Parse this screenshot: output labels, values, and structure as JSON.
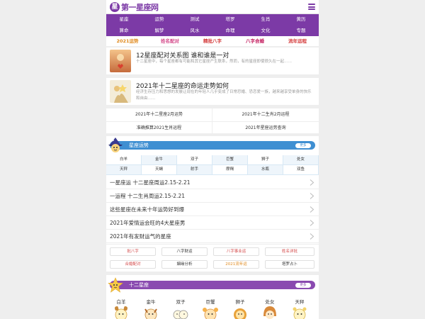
{
  "header": {
    "logo_text": "第一星座网",
    "logo_mark": "星"
  },
  "nav": {
    "row1": [
      "星座",
      "运势",
      "测试",
      "塔罗",
      "生肖",
      "黄历"
    ],
    "row2": [
      "算命",
      "解梦",
      "风水",
      "命理",
      "文化",
      "专题"
    ]
  },
  "hot_links": [
    {
      "label": "2021运势",
      "color": "#e08a1e"
    },
    {
      "label": "姓名配对",
      "color": "#d44a8a"
    },
    {
      "label": "精批八字",
      "color": "#d43b3b"
    },
    {
      "label": "八字合婚",
      "color": "#c2185b"
    },
    {
      "label": "流年运程",
      "color": "#d43b3b"
    }
  ],
  "articles": [
    {
      "title": "12星座配对关系图 谁和谁是一对",
      "desc": "十二星座中，每个星座都有可能和其它星座产生联系，然而，有的星座即使很久在一起……"
    },
    {
      "title": "2021年十二星座的命运走势如何",
      "desc": "经济生存压力和思想的发展让现在的年轻人几乎变成了日常恐婚、恐恋爱一族，越来越享受单身的快乐和自由……"
    }
  ],
  "link_grid": [
    "2021年十二星座2月运势",
    "2021年十二生肖2月运程",
    "准确推算2021生肖运程",
    "2021年星座运势查询"
  ],
  "horoscope": {
    "title": "星座运势",
    "more": "更多",
    "signs": [
      "白羊",
      "金牛",
      "双子",
      "巨蟹",
      "狮子",
      "处女",
      "天秤",
      "天蝎",
      "射手",
      "摩羯",
      "水瓶",
      "双鱼"
    ]
  },
  "articles_list": [
    "一星座运 十二星座周运2.15-2.21",
    "一运程 十二生肖周运2.15-2.21",
    "这些星座在未来十年运势好到爆",
    "2021年爱情运会旺的4大星座男",
    "2021年有发财运气的星座"
  ],
  "tags": [
    {
      "label": "批八字",
      "color": "#d44a4a"
    },
    {
      "label": "八字财运",
      "color": "#333333"
    },
    {
      "label": "八字事业运",
      "color": "#d44a4a"
    },
    {
      "label": "姓名详批",
      "color": "#d44a4a"
    },
    {
      "label": "合婚配对",
      "color": "#d44a4a"
    },
    {
      "label": "姻缘分析",
      "color": "#333333"
    },
    {
      "label": "2021流年运",
      "color": "#e08a1e"
    },
    {
      "label": "塔罗占卜",
      "color": "#333333"
    }
  ],
  "zodiac": {
    "title": "十二星座",
    "more": "更多",
    "names": [
      "白羊",
      "金牛",
      "双子",
      "巨蟹",
      "狮子",
      "处女",
      "天秤"
    ]
  },
  "colors": {
    "purple": "#7c3aa6",
    "blue": "#3f8fd2",
    "orange": "#e08a1e"
  }
}
